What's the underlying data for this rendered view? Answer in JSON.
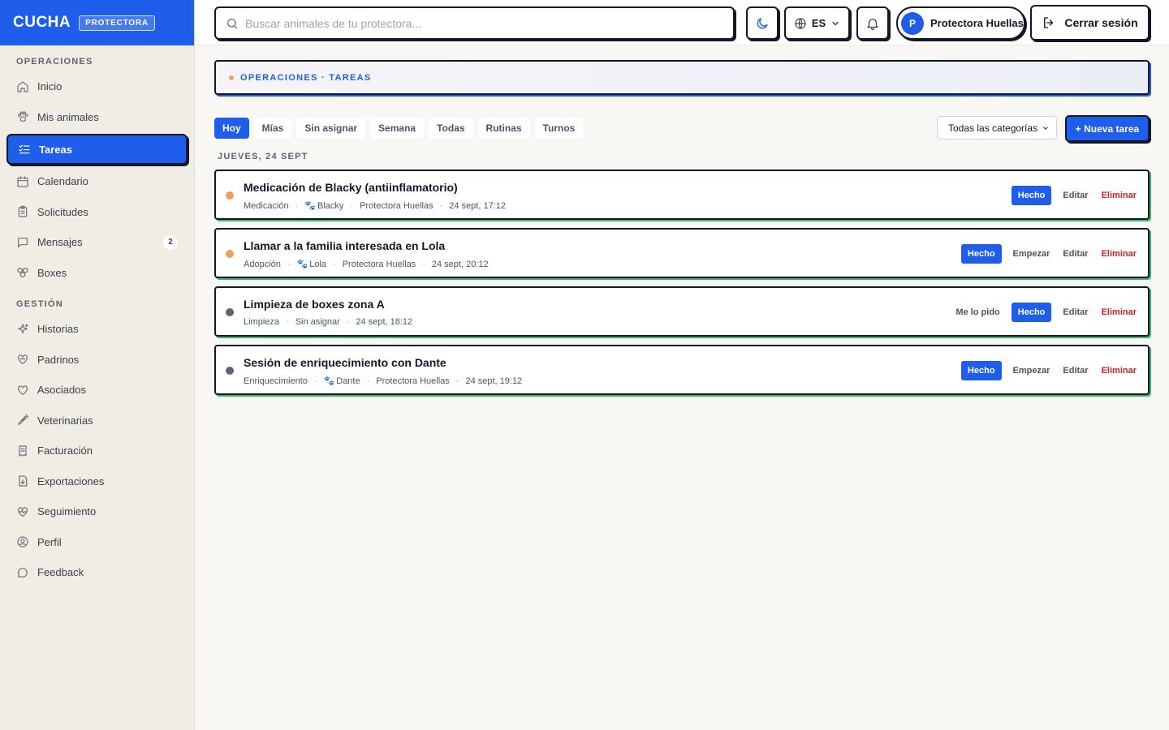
{
  "brand": {
    "name": "CUCHA",
    "badge": "PROTECTORA"
  },
  "sidebar": {
    "sections": [
      {
        "label": "OPERACIONES"
      },
      {
        "label": "GESTIÓN"
      }
    ],
    "operaciones": [
      {
        "label": "Inicio",
        "icon": "home-icon"
      },
      {
        "label": "Mis animales",
        "icon": "paw-icon"
      },
      {
        "label": "Tareas",
        "icon": "checklist-icon",
        "active": true
      },
      {
        "label": "Calendario",
        "icon": "calendar-icon"
      },
      {
        "label": "Solicitudes",
        "icon": "clipboard-icon"
      },
      {
        "label": "Mensajes",
        "icon": "message-icon",
        "count": "2"
      },
      {
        "label": "Boxes",
        "icon": "boxes-icon"
      }
    ],
    "gestion": [
      {
        "label": "Historias",
        "icon": "sparkles-icon"
      },
      {
        "label": "Padrinos",
        "icon": "heart-handshake-icon"
      },
      {
        "label": "Asociados",
        "icon": "heart-icon"
      },
      {
        "label": "Veterinarias",
        "icon": "syringe-icon"
      },
      {
        "label": "Facturación",
        "icon": "receipt-icon"
      },
      {
        "label": "Exportaciones",
        "icon": "file-download-icon"
      },
      {
        "label": "Seguimiento",
        "icon": "heart-pulse-icon"
      },
      {
        "label": "Perfil",
        "icon": "user-circle-icon"
      },
      {
        "label": "Feedback",
        "icon": "feedback-icon"
      }
    ]
  },
  "topbar": {
    "search_placeholder": "Buscar animales de tu protectora...",
    "language": "ES",
    "user_initial": "P",
    "user_name": "Protectora Huellas",
    "logout": "Cerrar sesión"
  },
  "breadcrumb": "OPERACIONES · TAREAS",
  "filters": [
    "Hoy",
    "Mías",
    "Sin asignar",
    "Semana",
    "Todas",
    "Rutinas",
    "Turnos"
  ],
  "active_filter": "Hoy",
  "category_select": "Todas las categorías",
  "new_task": "+ Nueva tarea",
  "day_label": "JUEVES, 24 SEPT",
  "tasks": [
    {
      "title": "Medicación de Blacky (antiinflamatorio)",
      "category": "Medicación",
      "animal": "Blacky",
      "assignee": "Protectora Huellas",
      "time": "24 sept, 17:12",
      "dot_color": "#f0a05a",
      "actions": {
        "done": "Hecho",
        "edit": "Editar",
        "delete": "Eliminar"
      }
    },
    {
      "title": "Llamar a la familia interesada en Lola",
      "category": "Adopción",
      "animal": "Lola",
      "assignee": "Protectora Huellas",
      "time": "24 sept, 20:12",
      "dot_color": "#f0a05a",
      "actions": {
        "done": "Hecho",
        "start": "Empezar",
        "edit": "Editar",
        "delete": "Eliminar"
      }
    },
    {
      "title": "Limpieza de boxes zona A",
      "category": "Limpieza",
      "assignee": "Sin asignar",
      "time": "24 sept, 18:12",
      "dot_color": "#5b6473",
      "actions": {
        "claim": "Me lo pido",
        "done": "Hecho",
        "edit": "Editar",
        "delete": "Eliminar"
      }
    },
    {
      "title": "Sesión de enriquecimiento con Dante",
      "category": "Enriquecimiento",
      "animal": "Dante",
      "assignee": "Protectora Huellas",
      "time": "24 sept, 19:12",
      "dot_color": "#5b6473",
      "actions": {
        "done": "Hecho",
        "start": "Empezar",
        "edit": "Editar",
        "delete": "Eliminar"
      }
    }
  ],
  "colors": {
    "accent": "#1e5eea",
    "success_shadow": "#3fb36a",
    "danger": "#c2262e"
  }
}
